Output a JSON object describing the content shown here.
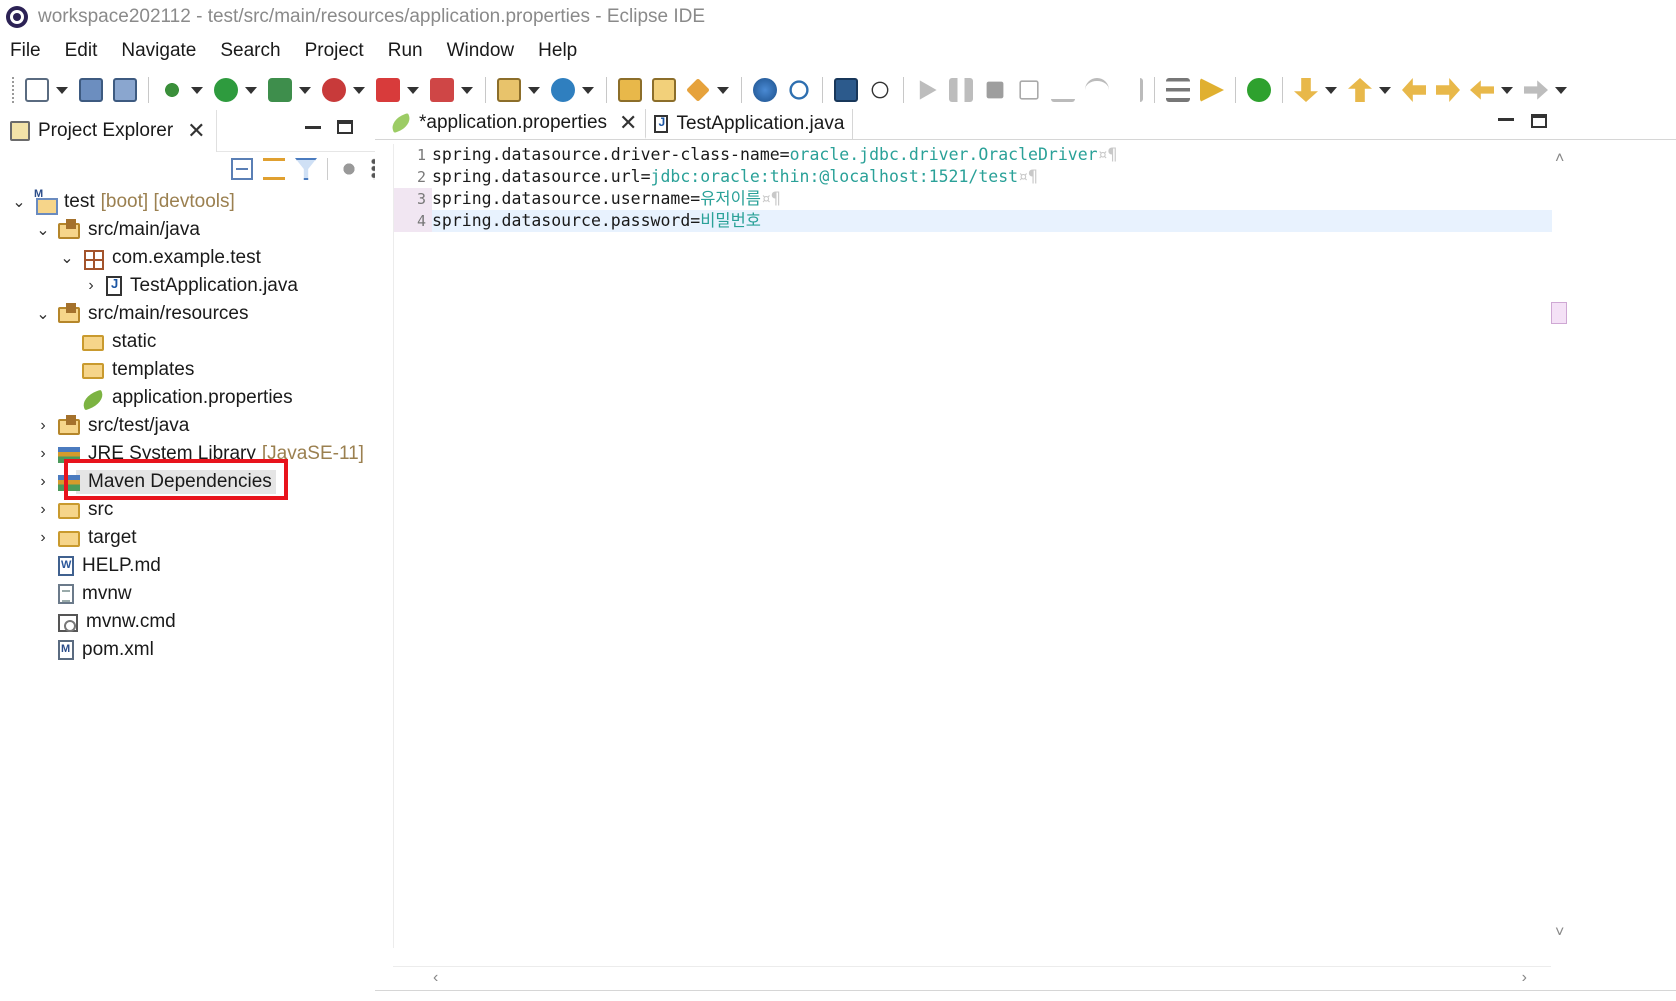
{
  "window": {
    "title": "workspace202112 - test/src/main/resources/application.properties - Eclipse IDE"
  },
  "menu": [
    "File",
    "Edit",
    "Navigate",
    "Search",
    "Project",
    "Run",
    "Window",
    "Help"
  ],
  "project_explorer": {
    "tab_label": "Project Explorer",
    "tree": [
      {
        "label": "test",
        "decoration": "[boot] [devtools]",
        "icon": "maven-project-icon",
        "expanded": true
      },
      {
        "label": "src/main/java",
        "icon": "source-folder-icon",
        "expanded": true
      },
      {
        "label": "com.example.test",
        "icon": "package-icon",
        "expanded": true
      },
      {
        "label": "TestApplication.java",
        "icon": "java-file-icon",
        "expanded": false
      },
      {
        "label": "src/main/resources",
        "icon": "source-folder-icon",
        "expanded": true
      },
      {
        "label": "static",
        "icon": "folder-icon"
      },
      {
        "label": "templates",
        "icon": "folder-icon"
      },
      {
        "label": "application.properties",
        "icon": "spring-leaf-icon",
        "selected": true
      },
      {
        "label": "src/test/java",
        "icon": "source-folder-icon",
        "expanded": false
      },
      {
        "label": "JRE System Library",
        "decoration": "[JavaSE-11]",
        "icon": "library-icon",
        "expanded": false
      },
      {
        "label": "Maven Dependencies",
        "icon": "library-icon",
        "expanded": false
      },
      {
        "label": "src",
        "icon": "folder-icon",
        "expanded": false
      },
      {
        "label": "target",
        "icon": "folder-icon",
        "expanded": false
      },
      {
        "label": "HELP.md",
        "icon": "markdown-file-icon"
      },
      {
        "label": "mvnw",
        "icon": "text-file-icon"
      },
      {
        "label": "mvnw.cmd",
        "icon": "cmd-file-icon"
      },
      {
        "label": "pom.xml",
        "icon": "maven-pom-icon"
      }
    ],
    "highlight_color": "#e8131c"
  },
  "editor": {
    "tabs": [
      {
        "label": "*application.properties",
        "active": true
      },
      {
        "label": "TestApplication.java",
        "active": false
      }
    ],
    "lines": [
      {
        "num": "1",
        "key": "spring.datasource.driver-class-name=",
        "value": "oracle.jdbc.driver.OracleDriver",
        "ws": "¤¶"
      },
      {
        "num": "2",
        "key": "spring.datasource.url=",
        "value": "jdbc:oracle:thin:@localhost:1521/test",
        "ws": "¤¶"
      },
      {
        "num": "3",
        "key": "spring.datasource.username=",
        "value": "유저이름",
        "ws": "¤¶"
      },
      {
        "num": "4",
        "key": "spring.datasource.password=",
        "value": "비밀번호",
        "ws": ""
      }
    ],
    "value_color": "#2aa198"
  }
}
